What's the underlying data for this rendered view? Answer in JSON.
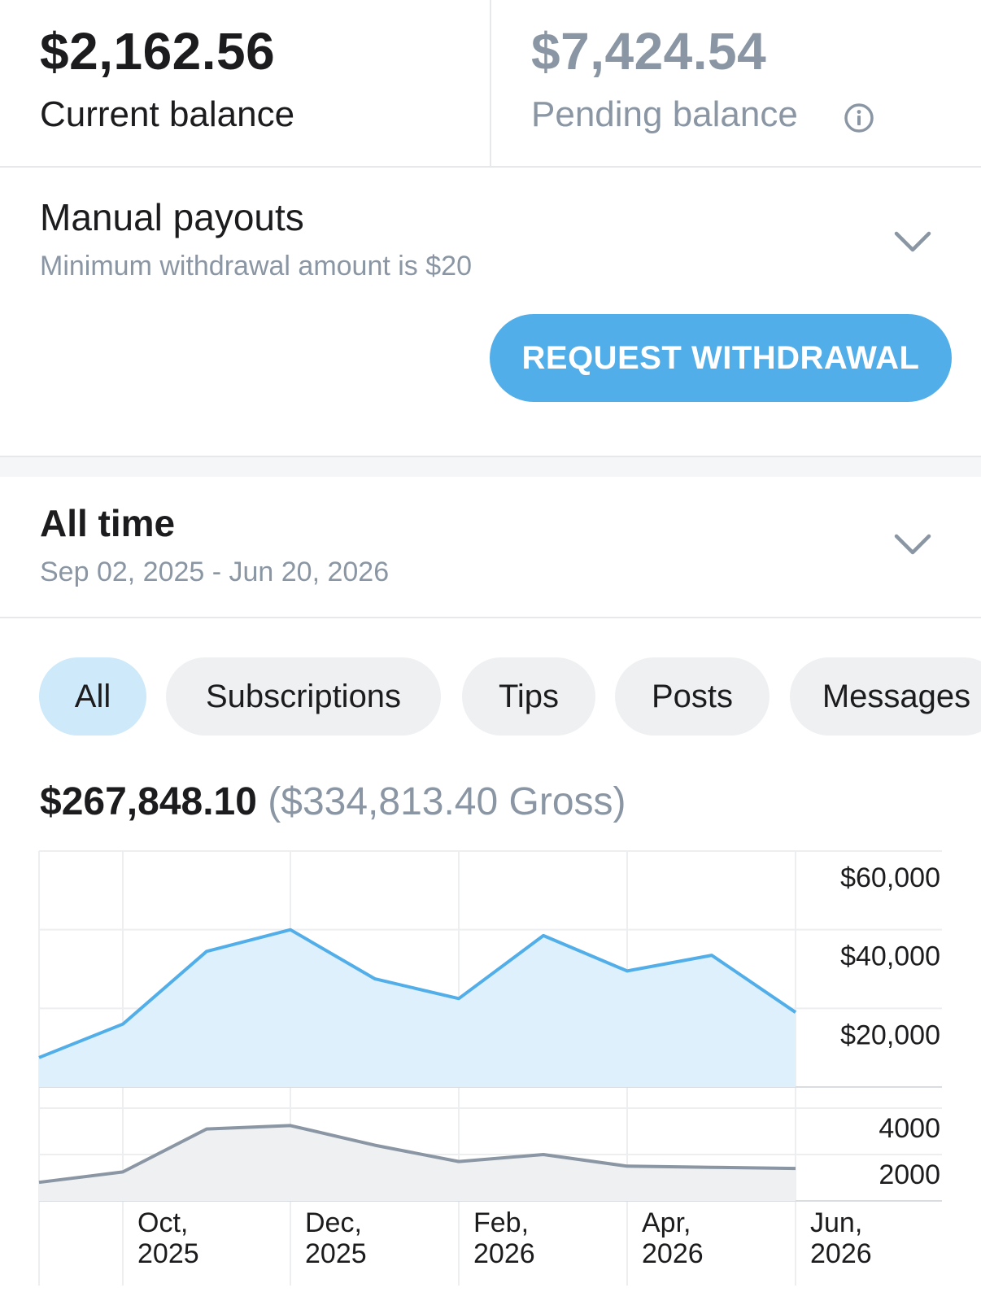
{
  "balances": {
    "current_amount": "$2,162.56",
    "current_label": "Current balance",
    "pending_amount": "$7,424.54",
    "pending_label": "Pending balance"
  },
  "payouts": {
    "title": "Manual payouts",
    "subtitle": "Minimum withdrawal amount is $20",
    "button_label": "REQUEST WITHDRAWAL"
  },
  "period": {
    "title": "All time",
    "range": "Sep 02, 2025 - Jun 20, 2026"
  },
  "filters": {
    "items": [
      "All",
      "Subscriptions",
      "Tips",
      "Posts",
      "Messages"
    ],
    "active": "All"
  },
  "totals": {
    "net": "$267,848.10",
    "gross": "($334,813.40 Gross)"
  },
  "colors": {
    "accent": "#52aee9",
    "accent_fill": "#ddf0fb",
    "secondary_line": "#8a96a3",
    "secondary_fill": "#eef0f2"
  },
  "chart_data": [
    {
      "type": "area",
      "x": [
        "2025-09-02",
        "2025-10-01",
        "2025-11-01",
        "2025-12-01",
        "2026-01-01",
        "2026-02-01",
        "2026-03-01",
        "2026-04-01",
        "2026-05-01",
        "2026-06-01"
      ],
      "series": [
        {
          "values": [
            7500,
            16000,
            34500,
            40000,
            27500,
            22500,
            38500,
            29500,
            33500,
            19000
          ]
        }
      ],
      "xticks": [
        "Oct, 2025",
        "Dec, 2025",
        "Feb, 2026",
        "Apr, 2026",
        "Jun, 2026"
      ],
      "yticks": [
        "$60,000",
        "$40,000",
        "$20,000"
      ],
      "ylim": [
        0,
        60000
      ],
      "grid": true
    },
    {
      "type": "area",
      "x": [
        "2025-09-02",
        "2025-10-01",
        "2025-11-01",
        "2025-12-01",
        "2026-01-01",
        "2026-02-01",
        "2026-03-01",
        "2026-04-01",
        "2026-05-01",
        "2026-06-01"
      ],
      "series": [
        {
          "values": [
            800,
            1250,
            3100,
            3250,
            2400,
            1700,
            2000,
            1500,
            1450,
            1400
          ]
        }
      ],
      "yticks": [
        "4000",
        "2000"
      ],
      "ylim": [
        0,
        4000
      ],
      "grid": true
    }
  ]
}
